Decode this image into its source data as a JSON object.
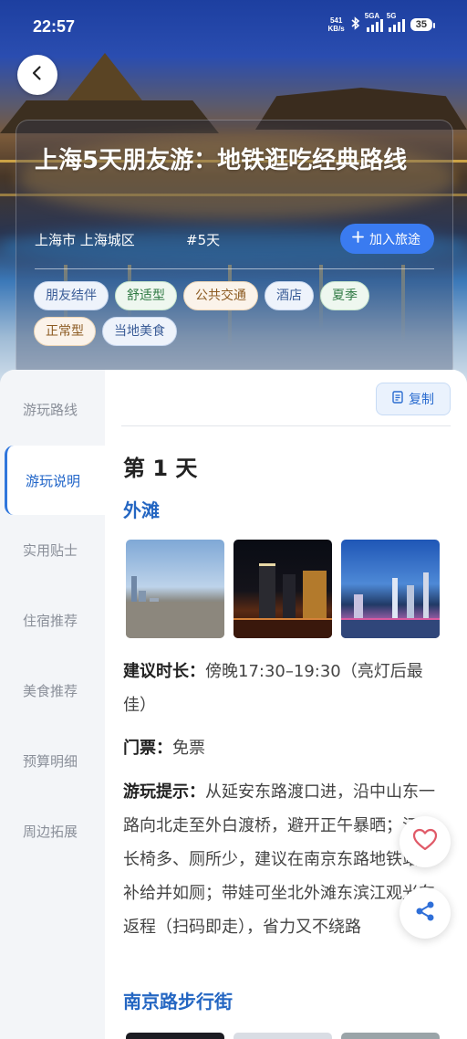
{
  "status_bar": {
    "time": "22:57",
    "net_speed_value": "541",
    "net_speed_unit": "KB/s",
    "sim1_label": "5GA",
    "sim2_label": "5G",
    "battery": "35"
  },
  "header": {
    "title": "上海5天朋友游：地铁逛吃经典路线",
    "location": "上海市 上海城区",
    "days_tag": "#5天",
    "add_button_label": "加入旅途",
    "tags": [
      {
        "label": "朋友结伴",
        "style": "blue"
      },
      {
        "label": "舒适型",
        "style": "green"
      },
      {
        "label": "公共交通",
        "style": "orange"
      },
      {
        "label": "酒店",
        "style": "blue"
      },
      {
        "label": "夏季",
        "style": "green"
      },
      {
        "label": "正常型",
        "style": "orange"
      },
      {
        "label": "当地美食",
        "style": "blue"
      }
    ]
  },
  "sidebar": {
    "items": [
      {
        "label": "游玩路线",
        "active": false
      },
      {
        "label": "游玩说明",
        "active": true
      },
      {
        "label": "实用贴士",
        "active": false
      },
      {
        "label": "住宿推荐",
        "active": false
      },
      {
        "label": "美食推荐",
        "active": false
      },
      {
        "label": "预算明细",
        "active": false
      },
      {
        "label": "周边拓展",
        "active": false
      }
    ]
  },
  "content": {
    "copy_label": "复制",
    "day_heading": "第 1 天",
    "spot1": {
      "title": "外滩",
      "duration_label": "建议时长：",
      "duration_value": "傍晚17:30–19:30（亮灯后最佳）",
      "ticket_label": "门票：",
      "ticket_value": "免票",
      "tips_label": "游玩提示：",
      "tips_value": "从延安东路渡口进，沿中山东一路向北走至外白渡桥，避开正午暴晒；江边长椅多、厕所少，建议在南京东路地铁站内补给并如厕；带娃可坐北外滩东滨江观光车返程（扫码即走），省力又不绕路"
    },
    "spot2": {
      "title": "南京路步行街"
    }
  },
  "icons": {
    "back": "chevron-left-icon",
    "add": "plus-icon",
    "copy": "document-icon",
    "favorite": "heart-icon",
    "share": "share-icon"
  },
  "colors": {
    "accent": "#3a7bf0",
    "spot_title": "#2466c2",
    "favorite": "#e05a68"
  }
}
